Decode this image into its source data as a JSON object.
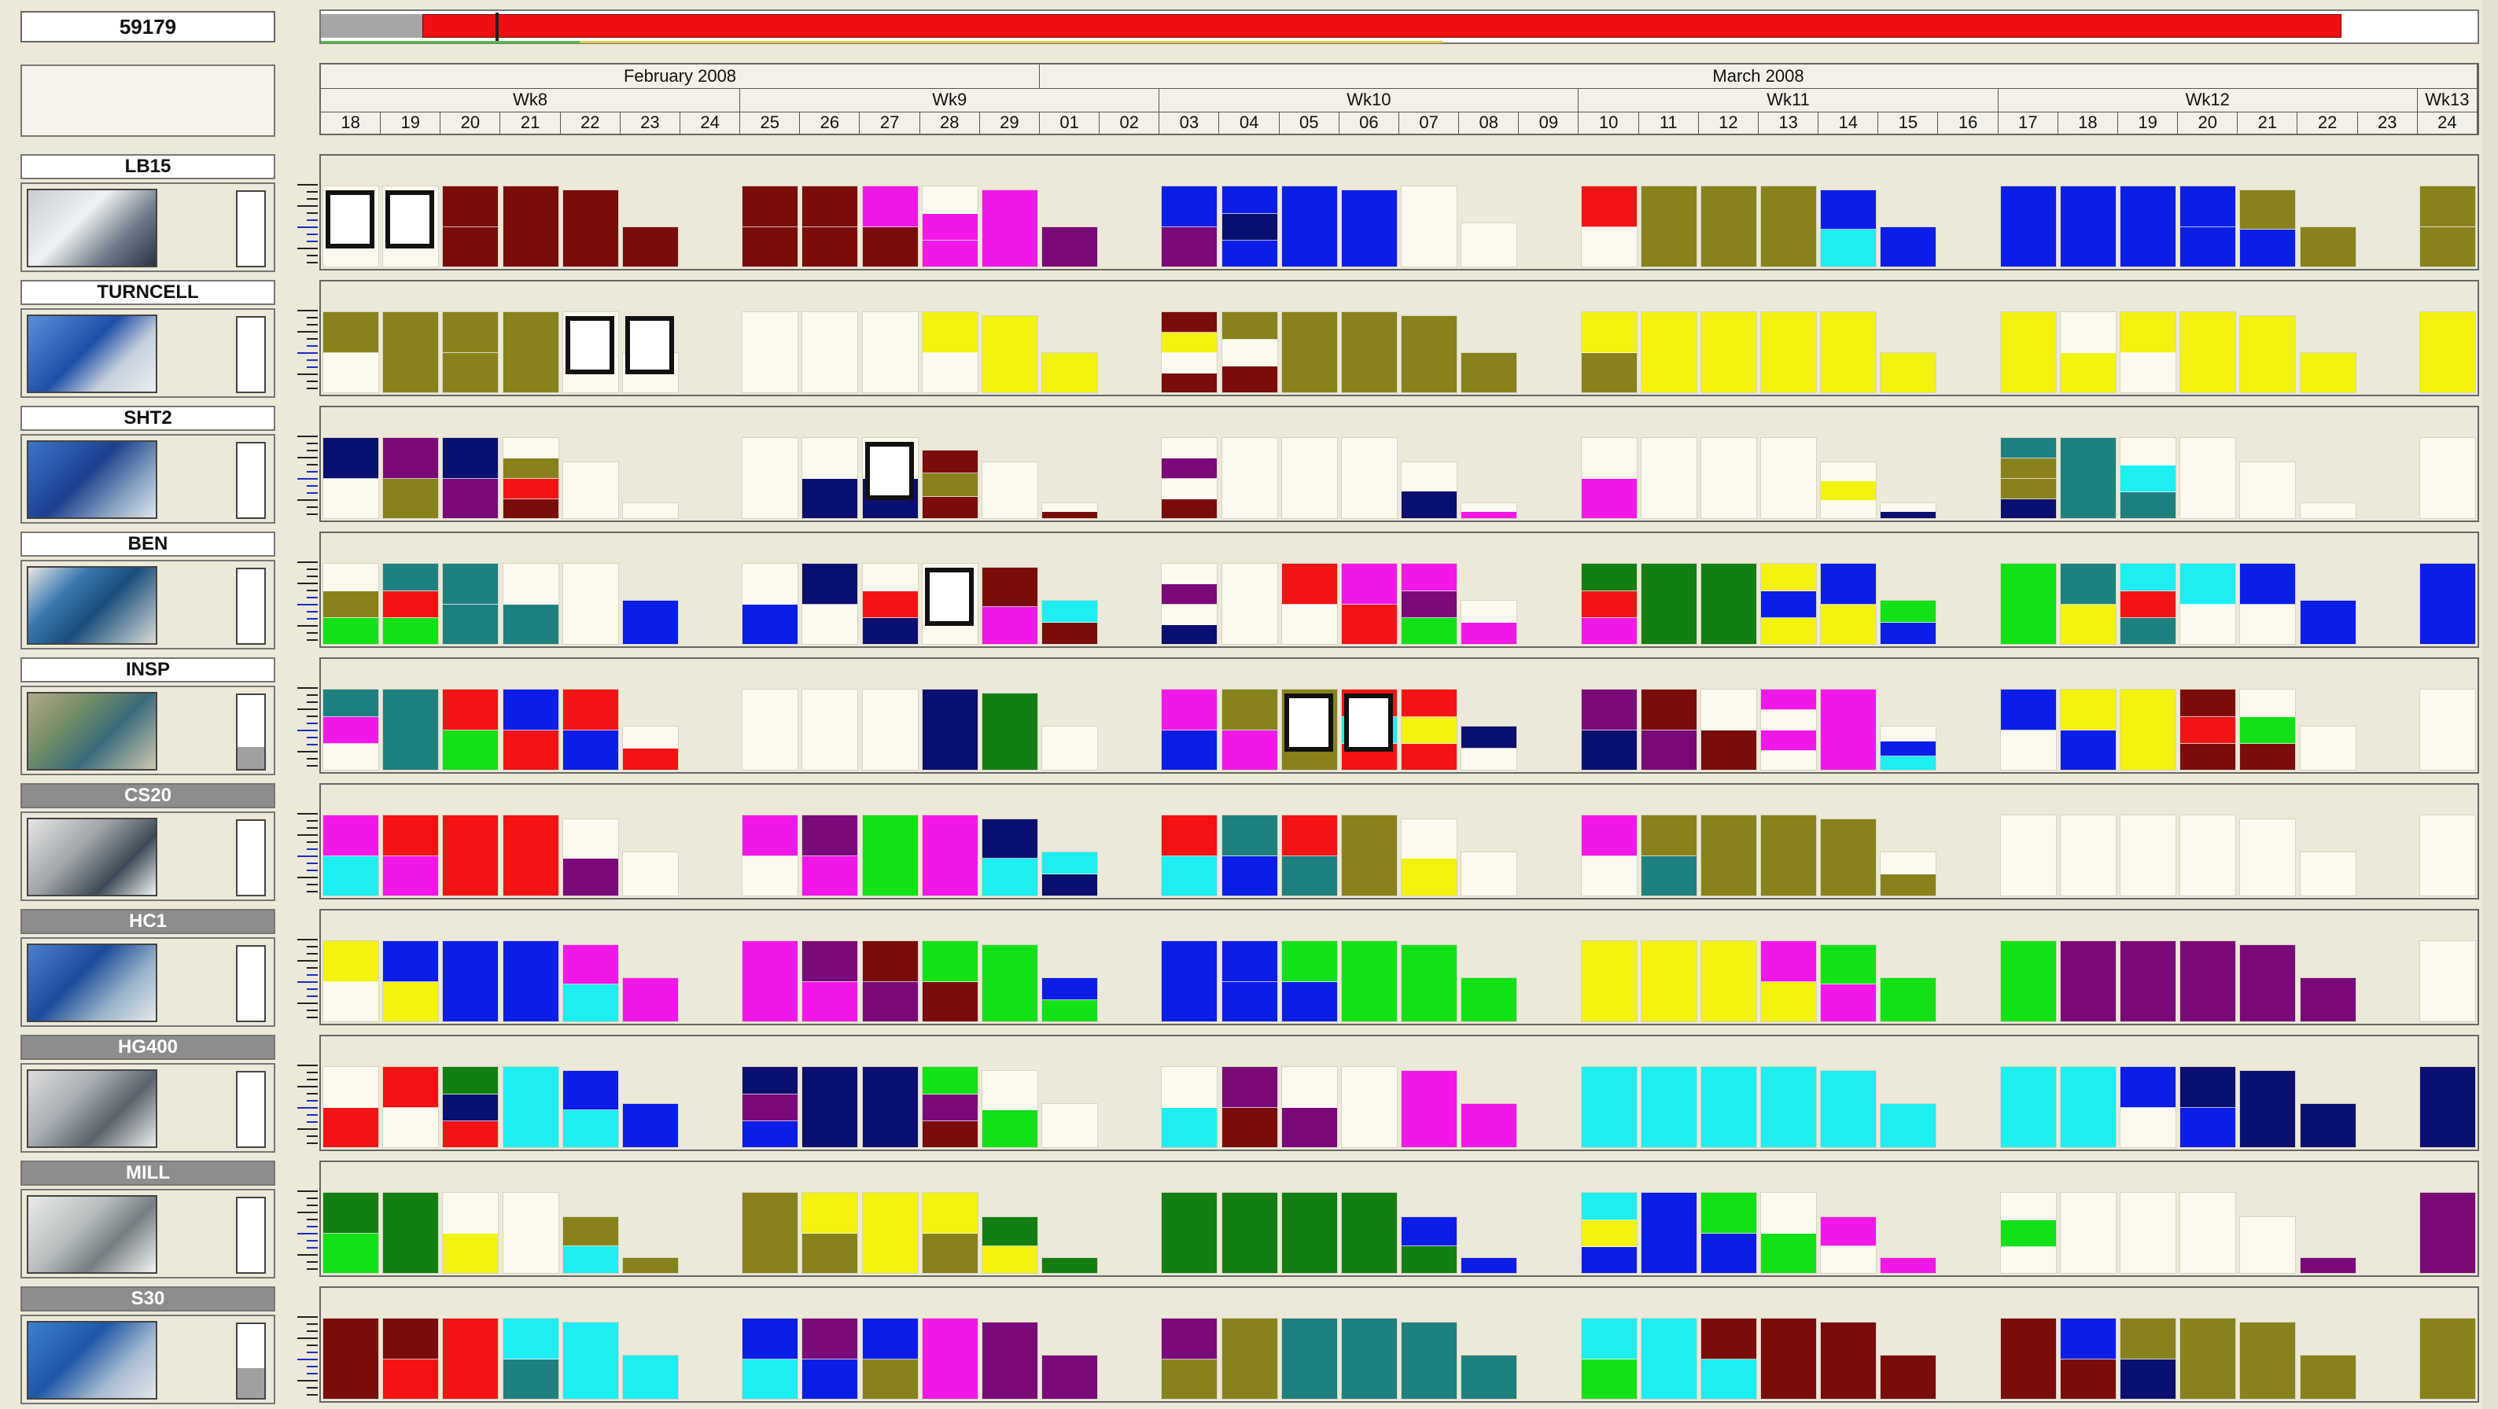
{
  "job": {
    "id": "59179"
  },
  "progress": {
    "grey_fraction": 0.047,
    "red_start": 0.047,
    "red_end": 0.937,
    "marker": 0.081
  },
  "calendar": {
    "months": [
      {
        "label": "February 2008",
        "start": 0,
        "span": 12
      },
      {
        "label": "March 2008",
        "start": 12,
        "span": 24
      }
    ],
    "weeks": [
      {
        "label": "Wk8",
        "start": 0,
        "span": 7
      },
      {
        "label": "Wk9",
        "start": 7,
        "span": 7
      },
      {
        "label": "Wk10",
        "start": 14,
        "span": 7
      },
      {
        "label": "Wk11",
        "start": 21,
        "span": 7
      },
      {
        "label": "Wk12",
        "start": 28,
        "span": 7
      },
      {
        "label": "Wk13",
        "start": 35,
        "span": 1
      }
    ],
    "days": [
      "18",
      "19",
      "20",
      "21",
      "22",
      "23",
      "24",
      "25",
      "26",
      "27",
      "28",
      "29",
      "01",
      "02",
      "03",
      "04",
      "05",
      "06",
      "07",
      "08",
      "09",
      "10",
      "11",
      "12",
      "13",
      "14",
      "15",
      "16",
      "17",
      "18",
      "19",
      "20",
      "21",
      "22",
      "23",
      "24"
    ]
  },
  "colors": {
    "M": "#7b0c0c",
    "O": "#87821c",
    "B": "#0b1ee8",
    "N": "#0a0f70",
    "P": "#f218e8",
    "V": "#7a0a7a",
    "Y": "#f4f210",
    "C": "#1ceef2",
    "T": "#1f8080",
    "G": "#13e117",
    "D": "#137f13",
    "R": "#f21414",
    "W": "#fcfaee"
  },
  "machines": [
    {
      "name": "LB15",
      "dark": false,
      "gauge": 0,
      "photo": "lathe-photo",
      "days": {
        "0": "W",
        "1": "W",
        "2": "M M",
        "3": "M",
        "4": "M",
        "5": "M",
        "7": "M M",
        "8": "M M",
        "9": "P M",
        "10": "W P P",
        "11": "P",
        "12": "V",
        "14": "B V",
        "15": "B N B",
        "16": "B",
        "17": "B",
        "18": "W",
        "19": "W",
        "21": "R W",
        "22": "O",
        "23": "O",
        "24": "O",
        "25": "B C",
        "26": "B",
        "28": "B",
        "29": "B",
        "30": "B",
        "31": "B B",
        "32": "O B",
        "33": "O",
        "35": "O O"
      },
      "heights": {
        "0": 1,
        "1": 1,
        "2": 1,
        "3": 1,
        "4": 0.95,
        "5": 0.5,
        "7": 1,
        "8": 1,
        "9": 1,
        "10": 1,
        "11": 0.95,
        "12": 0.5,
        "14": 1,
        "15": 1,
        "16": 1,
        "17": 0.95,
        "18": 1,
        "19": 0.55,
        "21": 1,
        "22": 1,
        "23": 1,
        "24": 1,
        "25": 0.95,
        "26": 0.5,
        "28": 1,
        "29": 1,
        "30": 1,
        "31": 1,
        "32": 0.95,
        "33": 0.5,
        "35": 1
      },
      "selected": [
        0,
        1
      ]
    },
    {
      "name": "TURNCELL",
      "dark": false,
      "gauge": 0,
      "photo": "turncell-photo",
      "days": {
        "0": "O W",
        "1": "O",
        "2": "O O",
        "3": "O",
        "4": "W",
        "5": "W",
        "7": "W",
        "8": "W",
        "9": "W",
        "10": "Y W",
        "11": "Y",
        "12": "Y",
        "14": "M Y W M",
        "15": "O W M",
        "16": "O",
        "17": "O",
        "18": "O",
        "19": "O",
        "21": "Y O",
        "22": "Y",
        "23": "Y",
        "24": "Y",
        "25": "Y",
        "26": "Y",
        "28": "Y",
        "29": "W Y",
        "30": "Y W",
        "31": "Y",
        "32": "Y",
        "33": "Y",
        "35": "Y"
      },
      "heights": {
        "0": 1,
        "1": 1,
        "2": 1,
        "3": 1,
        "4": 1,
        "5": 0.5,
        "7": 1,
        "8": 1,
        "9": 1,
        "10": 1,
        "11": 0.95,
        "12": 0.5,
        "14": 1,
        "15": 1,
        "16": 1,
        "17": 1,
        "18": 0.95,
        "19": 0.5,
        "21": 1,
        "22": 1,
        "23": 1,
        "24": 1,
        "25": 1,
        "26": 0.5,
        "28": 1,
        "29": 1,
        "30": 1,
        "31": 1,
        "32": 0.95,
        "33": 0.5,
        "35": 1
      },
      "selected": [
        4,
        5
      ]
    },
    {
      "name": "SHT2",
      "dark": false,
      "gauge": 0,
      "photo": "sht2-photo",
      "days": {
        "0": "N W",
        "1": "V O",
        "2": "N V",
        "3": "W O R M",
        "4": "W",
        "5": "W",
        "7": "W",
        "8": "W N",
        "9": "W N",
        "10": "M O M",
        "11": "W",
        "12": "W M",
        "14": "W V W M",
        "15": "W",
        "16": "W",
        "17": "W",
        "18": "W N",
        "19": "W P",
        "21": "W P",
        "22": "W",
        "23": "W",
        "24": "W",
        "25": "W Y W",
        "26": "W N",
        "28": "T O O N",
        "29": "T",
        "30": "W C T",
        "31": "W",
        "32": "W",
        "33": "W",
        "35": "W"
      },
      "heights": {
        "0": 1,
        "1": 1,
        "2": 1,
        "3": 1,
        "4": 0.7,
        "5": 0.2,
        "7": 1,
        "8": 1,
        "9": 1,
        "10": 0.85,
        "11": 0.7,
        "12": 0.2,
        "14": 1,
        "15": 1,
        "16": 1,
        "17": 1,
        "18": 0.7,
        "19": 0.2,
        "21": 1,
        "22": 1,
        "23": 1,
        "24": 1,
        "25": 0.7,
        "26": 0.2,
        "28": 1,
        "29": 1,
        "30": 1,
        "31": 1,
        "32": 0.7,
        "33": 0.2,
        "35": 1
      },
      "selected": [
        9
      ]
    },
    {
      "name": "BEN",
      "dark": false,
      "gauge": 0,
      "photo": "ben-photo",
      "days": {
        "0": "W O G",
        "1": "T R G",
        "2": "T T",
        "3": "W T",
        "4": "W",
        "5": "B",
        "7": "W B",
        "8": "N W",
        "9": "W R N",
        "10": "W",
        "11": "M P",
        "12": "C M",
        "14": "W V W N",
        "15": "W",
        "16": "R W",
        "17": "P R",
        "18": "P V G",
        "19": "W P",
        "21": "D R P",
        "22": "D",
        "23": "D",
        "24": "Y B Y",
        "25": "B Y",
        "26": "G B",
        "28": "G",
        "29": "T Y",
        "30": "C R T",
        "31": "C W",
        "32": "B W",
        "33": "B",
        "35": "B"
      },
      "heights": {
        "0": 1,
        "1": 1,
        "2": 1,
        "3": 1,
        "4": 1,
        "5": 0.55,
        "7": 1,
        "8": 1,
        "9": 1,
        "10": 1,
        "11": 0.95,
        "12": 0.55,
        "14": 1,
        "15": 1,
        "16": 1,
        "17": 1,
        "18": 1,
        "19": 0.55,
        "21": 1,
        "22": 1,
        "23": 1,
        "24": 1,
        "25": 1,
        "26": 0.55,
        "28": 1,
        "29": 1,
        "30": 1,
        "31": 1,
        "32": 1,
        "33": 0.55,
        "35": 1
      },
      "selected": [
        10
      ]
    },
    {
      "name": "INSP",
      "dark": false,
      "gauge": 0.3,
      "photo": "insp-photo",
      "days": {
        "0": "T P W",
        "1": "T",
        "2": "R G",
        "3": "B R",
        "4": "R B",
        "5": "W R",
        "7": "W",
        "8": "W",
        "9": "W",
        "10": "N",
        "11": "D",
        "12": "W",
        "14": "P B",
        "15": "O P",
        "16": "O",
        "17": "R C R",
        "18": "R Y R",
        "19": "N W",
        "21": "V N",
        "22": "M V",
        "23": "W M",
        "24": "P W P W",
        "25": "P",
        "26": "W B C",
        "28": "B W",
        "29": "Y B",
        "30": "Y",
        "31": "M R M",
        "32": "W G M",
        "33": "W",
        "35": "W"
      },
      "heights": {
        "0": 1,
        "1": 1,
        "2": 1,
        "3": 1,
        "4": 1,
        "5": 0.55,
        "7": 1,
        "8": 1,
        "9": 1,
        "10": 1,
        "11": 0.95,
        "12": 0.55,
        "14": 1,
        "15": 1,
        "16": 1,
        "17": 1,
        "18": 1,
        "19": 0.55,
        "21": 1,
        "22": 1,
        "23": 1,
        "24": 1,
        "25": 1,
        "26": 0.55,
        "28": 1,
        "29": 1,
        "30": 1,
        "31": 1,
        "32": 1,
        "33": 0.55,
        "35": 1
      },
      "selected": [
        16,
        17
      ]
    },
    {
      "name": "CS20",
      "dark": true,
      "gauge": 0,
      "photo": "cs20-photo",
      "days": {
        "0": "P C",
        "1": "R P",
        "2": "R",
        "3": "R",
        "4": "W V",
        "5": "W",
        "7": "P W",
        "8": "V P",
        "9": "G",
        "10": "P",
        "11": "N C",
        "12": "C N",
        "14": "R C",
        "15": "T B",
        "16": "R T",
        "17": "O",
        "18": "W Y",
        "19": "W",
        "21": "P W",
        "22": "O T",
        "23": "O",
        "24": "O",
        "25": "O",
        "26": "W O",
        "28": "W",
        "29": "W",
        "30": "W",
        "31": "W",
        "32": "W",
        "33": "W",
        "35": "W"
      },
      "heights": {
        "0": 1,
        "1": 1,
        "2": 1,
        "3": 1,
        "4": 0.95,
        "5": 0.55,
        "7": 1,
        "8": 1,
        "9": 1,
        "10": 1,
        "11": 0.95,
        "12": 0.55,
        "14": 1,
        "15": 1,
        "16": 1,
        "17": 1,
        "18": 0.95,
        "19": 0.55,
        "21": 1,
        "22": 1,
        "23": 1,
        "24": 1,
        "25": 0.95,
        "26": 0.55,
        "28": 1,
        "29": 1,
        "30": 1,
        "31": 1,
        "32": 0.95,
        "33": 0.55,
        "35": 1
      },
      "selected": []
    },
    {
      "name": "HC1",
      "dark": true,
      "gauge": 0,
      "photo": "hc1-photo",
      "days": {
        "0": "Y W",
        "1": "B Y",
        "2": "B",
        "3": "B",
        "4": "P C",
        "5": "P",
        "7": "P",
        "8": "V P",
        "9": "M V",
        "10": "G M",
        "11": "G",
        "12": "B G",
        "14": "B",
        "15": "B B",
        "16": "G B",
        "17": "G",
        "18": "G",
        "19": "G",
        "21": "Y",
        "22": "Y",
        "23": "Y",
        "24": "P Y",
        "25": "G P",
        "26": "G",
        "28": "G",
        "29": "V",
        "30": "V",
        "31": "V",
        "32": "V",
        "33": "V",
        "35": "W"
      },
      "heights": {
        "0": 1,
        "1": 1,
        "2": 1,
        "3": 1,
        "4": 0.95,
        "5": 0.55,
        "7": 1,
        "8": 1,
        "9": 1,
        "10": 1,
        "11": 0.95,
        "12": 0.55,
        "14": 1,
        "15": 1,
        "16": 1,
        "17": 1,
        "18": 0.95,
        "19": 0.55,
        "21": 1,
        "22": 1,
        "23": 1,
        "24": 1,
        "25": 0.95,
        "26": 0.55,
        "28": 1,
        "29": 1,
        "30": 1,
        "31": 1,
        "32": 0.95,
        "33": 0.55,
        "35": 1
      },
      "selected": []
    },
    {
      "name": "HG400",
      "dark": true,
      "gauge": 0,
      "photo": "hg400-photo",
      "days": {
        "0": "W R",
        "1": "R W",
        "2": "D N R",
        "3": "C",
        "4": "B C",
        "5": "B",
        "7": "N V B",
        "8": "N",
        "9": "N",
        "10": "G V M",
        "11": "W G",
        "12": "W",
        "14": "W C",
        "15": "V M",
        "16": "W V",
        "17": "W",
        "18": "P",
        "19": "P",
        "21": "C",
        "22": "C",
        "23": "C",
        "24": "C",
        "25": "C",
        "26": "C",
        "28": "C",
        "29": "C",
        "30": "B W",
        "31": "N B",
        "32": "N",
        "33": "N",
        "35": "N"
      },
      "heights": {
        "0": 1,
        "1": 1,
        "2": 1,
        "3": 1,
        "4": 0.95,
        "5": 0.55,
        "7": 1,
        "8": 1,
        "9": 1,
        "10": 1,
        "11": 0.95,
        "12": 0.55,
        "14": 1,
        "15": 1,
        "16": 1,
        "17": 1,
        "18": 0.95,
        "19": 0.55,
        "21": 1,
        "22": 1,
        "23": 1,
        "24": 1,
        "25": 0.95,
        "26": 0.55,
        "28": 1,
        "29": 1,
        "30": 1,
        "31": 1,
        "32": 0.95,
        "33": 0.55,
        "35": 1
      },
      "selected": []
    },
    {
      "name": "MILL",
      "dark": true,
      "gauge": 0,
      "photo": "mill-photo",
      "days": {
        "0": "D G",
        "1": "D",
        "2": "W Y",
        "3": "W",
        "4": "O C",
        "5": "O",
        "7": "O",
        "8": "Y O",
        "9": "Y",
        "10": "Y O",
        "11": "D Y",
        "12": "D",
        "14": "D",
        "15": "D",
        "16": "D",
        "17": "D",
        "18": "B D",
        "19": "B",
        "21": "C Y B",
        "22": "B",
        "23": "G B",
        "24": "W G",
        "25": "P W",
        "26": "P",
        "28": "W G W",
        "29": "W",
        "30": "W",
        "31": "W",
        "32": "W",
        "33": "V",
        "35": "V"
      },
      "heights": {
        "0": 1,
        "1": 1,
        "2": 1,
        "3": 1,
        "4": 0.7,
        "5": 0.2,
        "7": 1,
        "8": 1,
        "9": 1,
        "10": 1,
        "11": 0.7,
        "12": 0.2,
        "14": 1,
        "15": 1,
        "16": 1,
        "17": 1,
        "18": 0.7,
        "19": 0.2,
        "21": 1,
        "22": 1,
        "23": 1,
        "24": 1,
        "25": 0.7,
        "26": 0.2,
        "28": 1,
        "29": 1,
        "30": 1,
        "31": 1,
        "32": 0.7,
        "33": 0.2,
        "35": 1
      },
      "selected": []
    },
    {
      "name": "S30",
      "dark": true,
      "gauge": 0.4,
      "photo": "s30-photo",
      "days": {
        "0": "M",
        "1": "M R",
        "2": "R",
        "3": "C T",
        "4": "C",
        "5": "C",
        "7": "B C",
        "8": "V B",
        "9": "B O",
        "10": "P",
        "11": "V",
        "12": "V",
        "14": "V O",
        "15": "O",
        "16": "T",
        "17": "T",
        "18": "T",
        "19": "T",
        "21": "C G",
        "22": "C",
        "23": "M C",
        "24": "M",
        "25": "M",
        "26": "M",
        "28": "M",
        "29": "B M",
        "30": "O N",
        "31": "O",
        "32": "O",
        "33": "O",
        "35": "O"
      },
      "heights": {
        "0": 1,
        "1": 1,
        "2": 1,
        "3": 1,
        "4": 0.95,
        "5": 0.55,
        "7": 1,
        "8": 1,
        "9": 1,
        "10": 1,
        "11": 0.95,
        "12": 0.55,
        "14": 1,
        "15": 1,
        "16": 1,
        "17": 1,
        "18": 0.95,
        "19": 0.55,
        "21": 1,
        "22": 1,
        "23": 1,
        "24": 1,
        "25": 0.95,
        "26": 0.55,
        "28": 1,
        "29": 1,
        "30": 1,
        "31": 1,
        "32": 0.95,
        "33": 0.55,
        "35": 1
      },
      "selected": []
    }
  ]
}
